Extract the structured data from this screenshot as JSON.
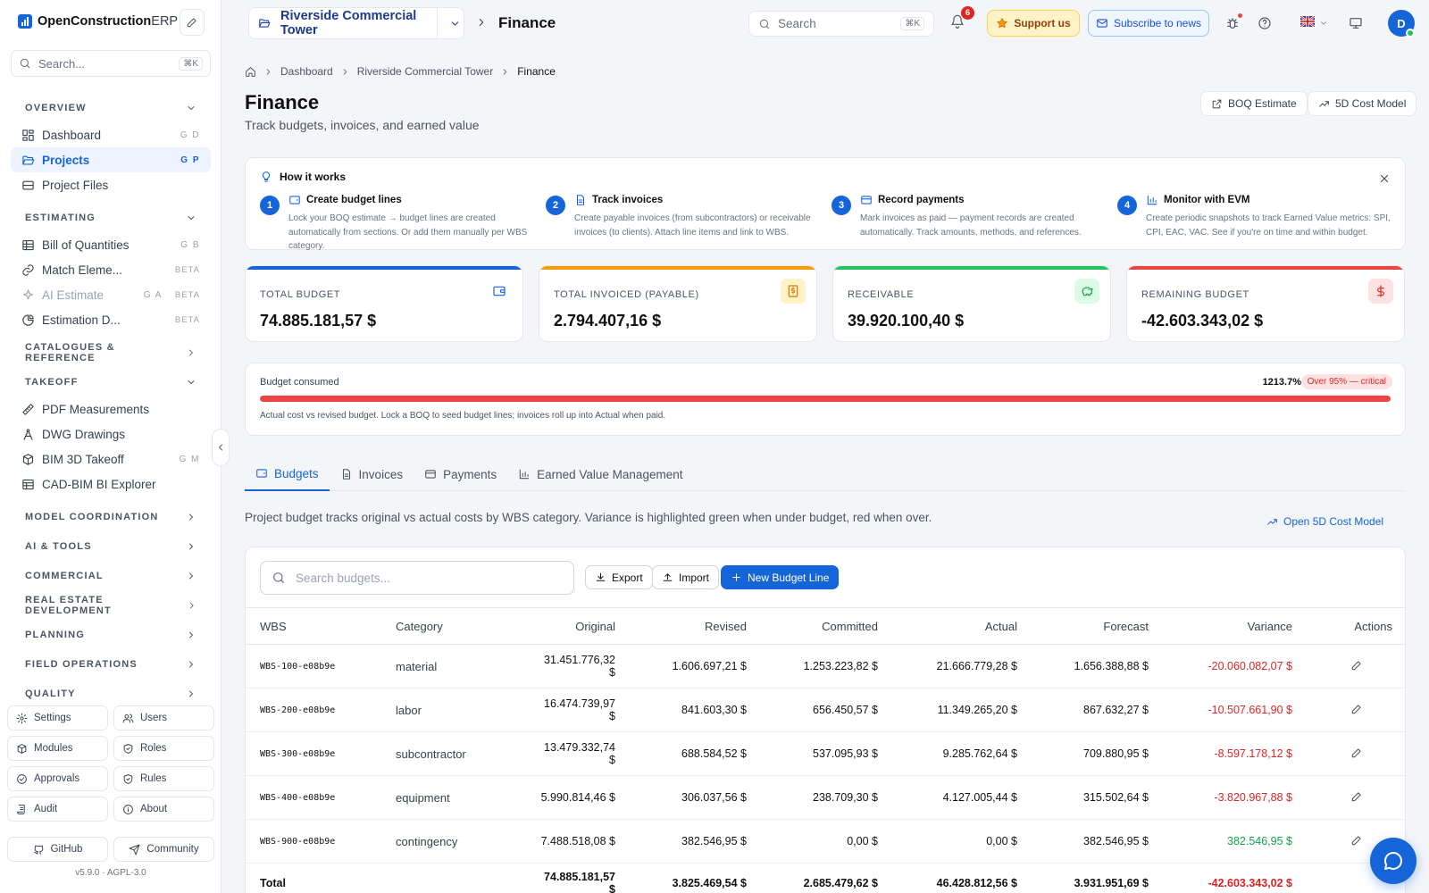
{
  "app": {
    "brand_bold": "OpenConstruction",
    "brand_rest": "ERP"
  },
  "sidebar": {
    "search_placeholder": "Search...",
    "search_kbd": "⌘K",
    "sections": {
      "overview": "OVERVIEW",
      "estimating": "ESTIMATING",
      "catalogues": "CATALOGUES & REFERENCE",
      "takeoff": "TAKEOFF",
      "model_coordination": "MODEL COORDINATION",
      "ai_tools": "AI & TOOLS",
      "commercial": "COMMERCIAL",
      "real_estate": "REAL ESTATE DEVELOPMENT",
      "planning": "PLANNING",
      "field_operations": "FIELD OPERATIONS",
      "quality": "QUALITY"
    },
    "items": {
      "dashboard": {
        "label": "Dashboard",
        "shortcut": "G D"
      },
      "projects": {
        "label": "Projects",
        "shortcut": "G P"
      },
      "project_files": {
        "label": "Project Files"
      },
      "boq": {
        "label": "Bill of Quantities",
        "shortcut": "G B"
      },
      "match": {
        "label": "Match Eleme...",
        "badge": "BETA"
      },
      "ai_estimate": {
        "label": "AI Estimate",
        "shortcut": "G A",
        "badge": "BETA"
      },
      "estimation_d": {
        "label": "Estimation D...",
        "badge": "BETA"
      },
      "pdf": {
        "label": "PDF Measurements"
      },
      "dwg": {
        "label": "DWG Drawings"
      },
      "bim": {
        "label": "BIM 3D Takeoff",
        "shortcut": "G M"
      },
      "cad": {
        "label": "CAD-BIM BI Explorer"
      }
    },
    "admin": {
      "settings": "Settings",
      "users": "Users",
      "modules": "Modules",
      "roles": "Roles",
      "approvals": "Approvals",
      "rules": "Rules",
      "audit": "Audit",
      "about": "About"
    },
    "links": {
      "github": "GitHub",
      "community": "Community"
    },
    "version": "v5.9.0 · AGPL-3.0"
  },
  "topbar": {
    "project": "Riverside Commercial Tower",
    "section": "Finance",
    "search_placeholder": "Search",
    "search_kbd": "⌘K",
    "notifications": "6",
    "support": "Support us",
    "subscribe": "Subscribe to news",
    "avatar": "D"
  },
  "breadcrumb": {
    "dashboard": "Dashboard",
    "project": "Riverside Commercial Tower",
    "current": "Finance"
  },
  "page": {
    "title": "Finance",
    "subtitle": "Track budgets, invoices, and earned value",
    "btn_boq": "BOQ Estimate",
    "btn_5d": "5D Cost Model"
  },
  "how": {
    "title": "How it works",
    "steps": [
      {
        "n": "1",
        "title": "Create budget lines",
        "desc": "Lock your BOQ estimate → budget lines are created automatically from sections. Or add them manually per WBS category."
      },
      {
        "n": "2",
        "title": "Track invoices",
        "desc": "Create payable invoices (from subcontractors) or receivable invoices (to clients). Attach line items and link to WBS."
      },
      {
        "n": "3",
        "title": "Record payments",
        "desc": "Mark invoices as paid — payment records are created automatically. Track amounts, methods, and references."
      },
      {
        "n": "4",
        "title": "Monitor with EVM",
        "desc": "Create periodic snapshots to track Earned Value metrics: SPI, CPI, EAC, VAC. See if you're on time and within budget."
      }
    ]
  },
  "kpis": [
    {
      "label": "TOTAL BUDGET",
      "value": "74.885.181,57 $",
      "color": "#1565d8"
    },
    {
      "label": "TOTAL INVOICED (PAYABLE)",
      "value": "2.794.407,16 $",
      "color": "#f59e0b"
    },
    {
      "label": "RECEIVABLE",
      "value": "39.920.100,40 $",
      "color": "#22c55e"
    },
    {
      "label": "REMAINING BUDGET",
      "value": "-42.603.343,02 $",
      "color": "#ef4444"
    }
  ],
  "consumed": {
    "label": "Budget consumed",
    "percent": "1213.7%",
    "fill": 1.0,
    "status": "Over 95% — critical",
    "note": "Actual cost vs revised budget. Lock a BOQ to seed budget lines; invoices roll up into Actual when paid."
  },
  "tabs": [
    "Budgets",
    "Invoices",
    "Payments",
    "Earned Value Management"
  ],
  "budgets": {
    "description": "Project budget tracks original vs actual costs by WBS category. Variance is highlighted green when under budget, red when over.",
    "open_5d": "Open 5D Cost Model",
    "search_placeholder": "Search budgets...",
    "export": "Export",
    "import": "Import",
    "new": "New Budget Line",
    "columns": [
      "WBS",
      "Category",
      "Original",
      "Revised",
      "Committed",
      "Actual",
      "Forecast",
      "Variance",
      "Actions"
    ],
    "rows": [
      {
        "wbs": "WBS-100-e08b9e",
        "category": "material",
        "original": "31.451.776,32 $",
        "revised": "1.606.697,21 $",
        "committed": "1.253.223,82 $",
        "actual": "21.666.779,28 $",
        "forecast": "1.656.388,88 $",
        "variance": "-20.060.082,07 $",
        "neg": true
      },
      {
        "wbs": "WBS-200-e08b9e",
        "category": "labor",
        "original": "16.474.739,97 $",
        "revised": "841.603,30 $",
        "committed": "656.450,57 $",
        "actual": "11.349.265,20 $",
        "forecast": "867.632,27 $",
        "variance": "-10.507.661,90 $",
        "neg": true
      },
      {
        "wbs": "WBS-300-e08b9e",
        "category": "subcontractor",
        "original": "13.479.332,74 $",
        "revised": "688.584,52 $",
        "committed": "537.095,93 $",
        "actual": "9.285.762,64 $",
        "forecast": "709.880,95 $",
        "variance": "-8.597.178,12 $",
        "neg": true
      },
      {
        "wbs": "WBS-400-e08b9e",
        "category": "equipment",
        "original": "5.990.814,46 $",
        "revised": "306.037,56 $",
        "committed": "238.709,30 $",
        "actual": "4.127.005,44 $",
        "forecast": "315.502,64 $",
        "variance": "-3.820.967,88 $",
        "neg": true
      },
      {
        "wbs": "WBS-900-e08b9e",
        "category": "contingency",
        "original": "7.488.518,08 $",
        "revised": "382.546,95 $",
        "committed": "0,00 $",
        "actual": "0,00 $",
        "forecast": "382.546,95 $",
        "variance": "382.546,95 $",
        "neg": false
      }
    ],
    "total": {
      "label": "Total",
      "original": "74.885.181,57 $",
      "revised": "3.825.469,54 $",
      "committed": "2.685.479,62 $",
      "actual": "46.428.812,56 $",
      "forecast": "3.931.951,69 $",
      "variance": "-42.603.343,02 $"
    }
  }
}
